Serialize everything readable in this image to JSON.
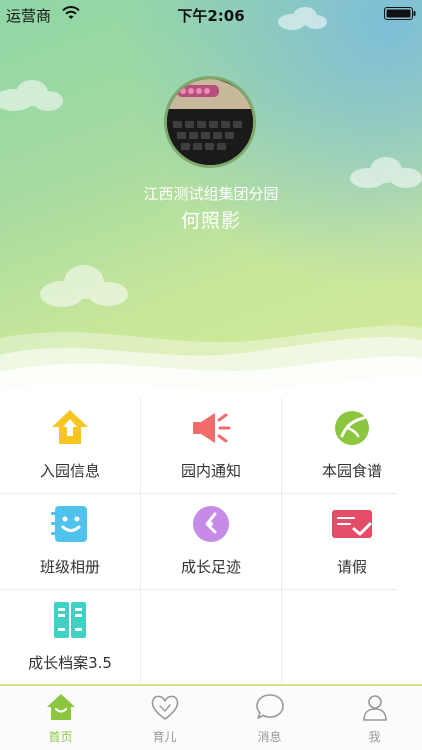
{
  "status_bar": {
    "carrier": "运营商",
    "time": "下午2:06"
  },
  "profile": {
    "school_name": "江西测试组集团分园",
    "user_name": "何照影"
  },
  "menu": {
    "items": [
      {
        "label": "入园信息",
        "icon": "house-arrow-icon",
        "color": "#f6c521"
      },
      {
        "label": "园内通知",
        "icon": "megaphone-icon",
        "color": "#f26b6b"
      },
      {
        "label": "本园食谱",
        "icon": "leaf-icon",
        "color": "#8cc63f"
      },
      {
        "label": "班级相册",
        "icon": "notebook-smiley-icon",
        "color": "#4fc3ec"
      },
      {
        "label": "成长足迹",
        "icon": "clock-icon",
        "color": "#c58be6"
      },
      {
        "label": "请假",
        "icon": "card-check-icon",
        "color": "#e34d67"
      },
      {
        "label": "成长档案3.5",
        "icon": "cabinet-icon",
        "color": "#41d1c4"
      }
    ]
  },
  "tabbar": {
    "tabs": [
      {
        "label": "首页",
        "icon": "home-icon",
        "active": true
      },
      {
        "label": "育儿",
        "icon": "heart-icon",
        "active": false
      },
      {
        "label": "消息",
        "icon": "chat-bubble-icon",
        "active": false
      },
      {
        "label": "我",
        "icon": "person-icon",
        "active": false
      }
    ],
    "active_color": "#8cc63f",
    "inactive_color": "#999999"
  }
}
